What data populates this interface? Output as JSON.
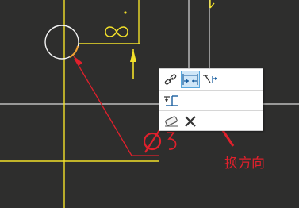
{
  "annotation": {
    "label": "换方向",
    "color": "#e8232e"
  },
  "context_toolbar": {
    "rows": [
      {
        "buttons": [
          {
            "icon": "chain-link-icon",
            "active": false
          },
          {
            "icon": "flip-dimension-direction-icon",
            "active": true
          },
          {
            "icon": "dimension-arrow-style-icon",
            "active": false
          }
        ]
      },
      {
        "buttons": [
          {
            "icon": "dimension-text-placement-icon",
            "active": false
          }
        ]
      },
      {
        "buttons": [
          {
            "icon": "eraser-icon",
            "active": false
          },
          {
            "icon": "close-icon",
            "active": false
          }
        ]
      }
    ]
  },
  "colors": {
    "background": "#2e2e2d",
    "sketch_yellow": "#f2e02a",
    "sketch_white": "#e8e8e8",
    "dimension_red": "#e0202c",
    "highlight_blue": "#56a6dc"
  }
}
